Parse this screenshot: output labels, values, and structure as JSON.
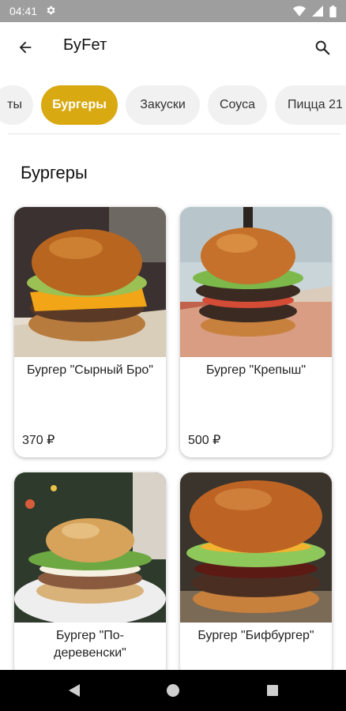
{
  "status_bar": {
    "time": "04:41",
    "icons": [
      "gear-icon",
      "wifi-icon",
      "signal-icon",
      "battery-icon"
    ]
  },
  "app_bar": {
    "title": "БуFет",
    "back_icon": "arrow-back-icon",
    "search_icon": "search-icon"
  },
  "categories": [
    {
      "label": "ты",
      "active": false
    },
    {
      "label": "Бургеры",
      "active": true
    },
    {
      "label": "Закуски",
      "active": false
    },
    {
      "label": "Соуса",
      "active": false
    },
    {
      "label": "Пицца 21",
      "active": false
    }
  ],
  "section": {
    "title": "Бургеры"
  },
  "products": [
    {
      "name": "Бургер \"Сырный Бро\"",
      "price": "370 ₽"
    },
    {
      "name": "Бургер \"Крепыш\"",
      "price": "500 ₽"
    },
    {
      "name": "Бургер \"По-деревенски\"",
      "price": ""
    },
    {
      "name": "Бургер \"Бифбургер\"",
      "price": ""
    }
  ],
  "colors": {
    "accent": "#d9a912",
    "status_bar": "#9e9e9e",
    "nav_bar": "#000000"
  }
}
